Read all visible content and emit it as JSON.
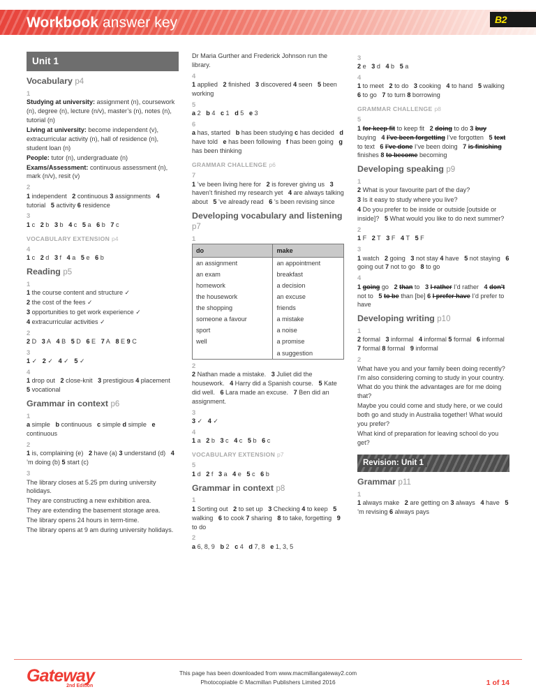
{
  "header": {
    "title_bold": "Workbook",
    "title_light": " answer key",
    "level_badge": "B2"
  },
  "column1": {
    "unit_bar": "Unit 1",
    "sections": [
      {
        "kind": "section",
        "title": "Vocabulary",
        "page": "p4"
      },
      {
        "kind": "exno",
        "text": "1"
      },
      {
        "kind": "ans",
        "html": "<b>Studying at university:</b> assignment (n), coursework (n), degree (n), lecture (n/v), master&rsquo;s (n), notes (n), tutorial (n)"
      },
      {
        "kind": "ans",
        "html": "<b>Living at university:</b> become independent (v), extracurricular activity (n), hall of residence (n), student loan (n)"
      },
      {
        "kind": "ans",
        "html": "<b>People:</b> tutor (n), undergraduate (n)"
      },
      {
        "kind": "ans",
        "html": "<b>Exams/Assessment:</b> continuous assessment (n), mark (n/v), resit (v)"
      },
      {
        "kind": "exno",
        "text": "2"
      },
      {
        "kind": "ans",
        "html": "<b>1</b> independent&nbsp;&nbsp; <b>2</b> continuous <b>3</b> assignments&nbsp;&nbsp; <b>4</b> tutorial&nbsp;&nbsp; <b>5</b> activity <b>6</b> residence"
      },
      {
        "kind": "exno",
        "text": "3"
      },
      {
        "kind": "ans",
        "html": "<b>1</b> c&nbsp;&nbsp; <b>2</b> b&nbsp;&nbsp; <b>3</b> b&nbsp;&nbsp; <b>4</b> c&nbsp;&nbsp; <b>5</b> a&nbsp;&nbsp; <b>6</b> b&nbsp;&nbsp; <b>7</b> c"
      },
      {
        "kind": "subsec",
        "title": "VOCABULARY EXTENSION",
        "page": "p4"
      },
      {
        "kind": "exno",
        "text": "4"
      },
      {
        "kind": "ans",
        "html": "<b>1</b> c&nbsp;&nbsp; <b>2</b> d&nbsp;&nbsp; <b>3</b> f&nbsp;&nbsp; <b>4</b> a&nbsp;&nbsp; <b>5</b> e&nbsp;&nbsp; <b>6</b> b"
      },
      {
        "kind": "section",
        "title": "Reading",
        "page": "p5"
      },
      {
        "kind": "exno",
        "text": "1"
      },
      {
        "kind": "ans",
        "html": "<b>1</b> the course content and structure &#10003;"
      },
      {
        "kind": "ans",
        "html": "<b>2</b> the cost of the fees &#10003;"
      },
      {
        "kind": "ans",
        "html": "<b>3</b> opportunities to get work experience &#10003;"
      },
      {
        "kind": "ans",
        "html": "<b>4</b> extracurricular activities &#10003;"
      },
      {
        "kind": "exno",
        "text": "2"
      },
      {
        "kind": "ans",
        "html": "<b>2</b> D&nbsp;&nbsp; <b>3</b> A&nbsp;&nbsp; <b>4</b> B&nbsp;&nbsp; <b>5</b> D&nbsp;&nbsp; <b>6</b> E&nbsp;&nbsp; <b>7</b> A&nbsp;&nbsp; <b>8</b> E <b>9</b> C"
      },
      {
        "kind": "exno",
        "text": "3"
      },
      {
        "kind": "ans",
        "html": "<b>1</b> &#10003;&nbsp;&nbsp; <b>2</b> &#10003;&nbsp;&nbsp; <b>4</b> &#10003;&nbsp;&nbsp; <b>5</b> &#10003;"
      },
      {
        "kind": "exno",
        "text": "4"
      },
      {
        "kind": "ans",
        "html": "<b>1</b> drop out&nbsp;&nbsp; <b>2</b> close-knit&nbsp;&nbsp; <b>3</b> prestigious <b>4</b> placement&nbsp;&nbsp; <b>5</b> vocational"
      },
      {
        "kind": "section",
        "title": "Grammar in context",
        "page": "p6"
      },
      {
        "kind": "exno",
        "text": "1"
      },
      {
        "kind": "ans",
        "html": "<b>a</b> simple&nbsp;&nbsp; <b>b</b> continuous&nbsp;&nbsp; <b>c</b> simple <b>d</b> simple&nbsp;&nbsp; <b>e</b> continuous"
      },
      {
        "kind": "exno",
        "text": "2"
      },
      {
        "kind": "ans",
        "html": "<b>1</b> is, complaining (e)&nbsp;&nbsp; <b>2</b> have (a) <b>3</b> understand (d)&nbsp;&nbsp; <b>4</b> &rsquo;m doing (b) <b>5</b> start (c)"
      },
      {
        "kind": "exno",
        "text": "3"
      },
      {
        "kind": "ans",
        "html": "The library closes at 5.25 pm during university holidays."
      },
      {
        "kind": "ans",
        "html": "They are constructing a new exhibition area."
      },
      {
        "kind": "ans",
        "html": "They are extending the basement storage area."
      },
      {
        "kind": "ans",
        "html": "The library opens 24 hours in term-time."
      },
      {
        "kind": "ans",
        "html": "The library opens at 9 am during university holidays."
      }
    ]
  },
  "column2": {
    "sections": [
      {
        "kind": "ans",
        "html": "Dr Maria Gurther and Frederick Johnson run the library."
      },
      {
        "kind": "exno",
        "text": "4"
      },
      {
        "kind": "ans",
        "html": "<b>1</b> applied&nbsp;&nbsp; <b>2</b> finished&nbsp;&nbsp; <b>3</b> discovered <b>4</b> seen&nbsp;&nbsp; <b>5</b> been working"
      },
      {
        "kind": "exno",
        "text": "5"
      },
      {
        "kind": "ans",
        "html": "<b>a</b> 2&nbsp;&nbsp; <b>b</b> 4&nbsp;&nbsp; <b>c</b> 1&nbsp;&nbsp; <b>d</b> 5&nbsp;&nbsp; <b>e</b> 3"
      },
      {
        "kind": "exno",
        "text": "6"
      },
      {
        "kind": "ans",
        "html": "<b>a</b> has, started&nbsp;&nbsp; <b>b</b> has been studying <b>c</b> has decided&nbsp;&nbsp; <b>d</b> have told&nbsp;&nbsp; <b>e</b> has been following&nbsp;&nbsp; <b>f</b> has been going&nbsp;&nbsp; <b>g</b> has been thinking"
      },
      {
        "kind": "subsec",
        "title": "GRAMMAR CHALLENGE",
        "page": "p6"
      },
      {
        "kind": "exno",
        "text": "7"
      },
      {
        "kind": "ans",
        "html": "<b>1</b> &rsquo;ve been living here for&nbsp;&nbsp; <b>2</b> is forever giving us&nbsp;&nbsp; <b>3</b> haven&rsquo;t finished my research yet&nbsp;&nbsp; <b>4</b> are always talking about&nbsp;&nbsp; <b>5</b> &rsquo;ve already read&nbsp;&nbsp; <b>6</b> &rsquo;s been revising since"
      },
      {
        "kind": "section",
        "title": "Developing vocabulary and listening",
        "page": "p7"
      },
      {
        "kind": "exno",
        "text": "1"
      },
      {
        "kind": "table"
      },
      {
        "kind": "exno",
        "text": "2"
      },
      {
        "kind": "ans",
        "html": "<b>2</b> Nathan made a mistake.&nbsp;&nbsp; <b>3</b> Juliet did the housework.&nbsp;&nbsp; <b>4</b> Harry did a Spanish course.&nbsp;&nbsp; <b>5</b> Kate did well.&nbsp;&nbsp; <b>6</b> Lara made an excuse.&nbsp;&nbsp; <b>7</b> Ben did an assignment."
      },
      {
        "kind": "exno",
        "text": "3"
      },
      {
        "kind": "ans",
        "html": "<b>3</b> &#10003;&nbsp;&nbsp; <b>4</b> &#10003;"
      },
      {
        "kind": "exno",
        "text": "4"
      },
      {
        "kind": "ans",
        "html": "<b>1</b> a&nbsp;&nbsp; <b>2</b> b&nbsp;&nbsp; <b>3</b> c&nbsp;&nbsp; <b>4</b> c&nbsp;&nbsp; <b>5</b> b&nbsp;&nbsp; <b>6</b> c"
      },
      {
        "kind": "subsec",
        "title": "VOCABULARY EXTENSION",
        "page": "p7"
      },
      {
        "kind": "exno",
        "text": "5"
      },
      {
        "kind": "ans",
        "html": "<b>1</b> d&nbsp;&nbsp; <b>2</b> f&nbsp;&nbsp; <b>3</b> a&nbsp;&nbsp; <b>4</b> e&nbsp;&nbsp; <b>5</b> c&nbsp;&nbsp; <b>6</b> b"
      },
      {
        "kind": "section",
        "title": "Grammar in context",
        "page": "p8"
      },
      {
        "kind": "exno",
        "text": "1"
      },
      {
        "kind": "ans",
        "html": "<b>1</b> Sorting out&nbsp;&nbsp; <b>2</b> to set up&nbsp;&nbsp; <b>3</b> Checking <b>4</b> to keep&nbsp;&nbsp; <b>5</b> walking&nbsp;&nbsp; <b>6</b> to cook <b>7</b> sharing&nbsp;&nbsp; <b>8</b> to take, forgetting&nbsp;&nbsp; <b>9</b> to do"
      },
      {
        "kind": "exno",
        "text": "2"
      },
      {
        "kind": "ans",
        "html": "<b>a</b> 6, 8, 9&nbsp;&nbsp; <b>b</b> 2&nbsp;&nbsp; <b>c</b> 4&nbsp;&nbsp; <b>d</b> 7, 8&nbsp;&nbsp; <b>e</b> 1, 3, 5"
      }
    ],
    "table": {
      "headers": [
        "do",
        "make"
      ],
      "rows": [
        [
          "an assignment",
          "an appointment"
        ],
        [
          "an exam",
          "breakfast"
        ],
        [
          "homework",
          "a decision"
        ],
        [
          "the housework",
          "an excuse"
        ],
        [
          "the shopping",
          "friends"
        ],
        [
          "someone a favour",
          "a mistake"
        ],
        [
          "sport",
          "a noise"
        ],
        [
          "well",
          "a promise"
        ],
        [
          "",
          "a suggestion"
        ]
      ]
    }
  },
  "column3": {
    "sections": [
      {
        "kind": "exno",
        "text": "3"
      },
      {
        "kind": "ans",
        "html": "<b>2</b> e&nbsp;&nbsp; <b>3</b> d&nbsp;&nbsp; <b>4</b> b&nbsp;&nbsp; <b>5</b> a"
      },
      {
        "kind": "exno",
        "text": "4"
      },
      {
        "kind": "ans",
        "html": "<b>1</b> to meet&nbsp;&nbsp; <b>2</b> to do&nbsp;&nbsp; <b>3</b> cooking&nbsp;&nbsp; <b>4</b> to hand&nbsp;&nbsp; <b>5</b> walking&nbsp;&nbsp; <b>6</b> to go&nbsp;&nbsp; <b>7</b> to turn <b>8</b> borrowing"
      },
      {
        "kind": "subsec",
        "title": "GRAMMAR CHALLENGE",
        "page": "p8"
      },
      {
        "kind": "exno",
        "text": "5"
      },
      {
        "kind": "ans",
        "html": "<b>1</b> <span class=\"strike\">for keep fit</span> to keep fit&nbsp;&nbsp; <b>2</b> <span class=\"strike\">doing</span> to do <b>3</b> <span class=\"strike\">buy</span> buying&nbsp;&nbsp; <b>4</b> <span class=\"strike\">I&rsquo;ve been forgetting</span> I&rsquo;ve forgotten&nbsp;&nbsp; <b>5</b> <span class=\"strike\">text</span> to text&nbsp;&nbsp; <b>6</b> <span class=\"strike\">I&rsquo;ve done</span> I&rsquo;ve been doing&nbsp;&nbsp; <b>7</b> <span class=\"strike\">is finishing</span> finishes <b>8</b> <span class=\"strike\">to become</span> becoming"
      },
      {
        "kind": "section",
        "title": "Developing speaking",
        "page": "p9"
      },
      {
        "kind": "exno",
        "text": "1"
      },
      {
        "kind": "ans",
        "html": "<b>2</b> What is your favourite part of the day?"
      },
      {
        "kind": "ans",
        "html": "<b>3</b> Is it easy to study where you live?"
      },
      {
        "kind": "ans",
        "html": "<b>4</b> Do you prefer to be inside or outside [outside or inside]?&nbsp;&nbsp; <b>5</b> What would you like to do next summer?"
      },
      {
        "kind": "exno",
        "text": "2"
      },
      {
        "kind": "ans",
        "html": "<b>1</b> F&nbsp;&nbsp; <b>2</b> T&nbsp;&nbsp; <b>3</b> F&nbsp;&nbsp; <b>4</b> T&nbsp;&nbsp; <b>5</b> F"
      },
      {
        "kind": "exno",
        "text": "3"
      },
      {
        "kind": "ans",
        "html": "<b>1</b> watch&nbsp;&nbsp; <b>2</b> going&nbsp;&nbsp; <b>3</b> not stay <b>4</b> have&nbsp;&nbsp; <b>5</b> not staying&nbsp;&nbsp; <b>6</b> going out <b>7</b> not to go&nbsp;&nbsp; <b>8</b> to go"
      },
      {
        "kind": "exno",
        "text": "4"
      },
      {
        "kind": "ans",
        "html": "<b>1</b> <span class=\"strike\">going</span> go&nbsp;&nbsp; <b>2</b> <span class=\"strike\">than</span> to&nbsp;&nbsp; <b>3</b> <span class=\"strike\">I rather</span> I&rsquo;d rather&nbsp;&nbsp; <b>4</b> <span class=\"strike\">don&rsquo;t</span> not to&nbsp;&nbsp; <b>5</b> <span class=\"strike\">to be</span> than [be] <b>6</b> <span class=\"strike\">I prefer have</span> I&rsquo;d prefer to have"
      },
      {
        "kind": "section",
        "title": "Developing writing",
        "page": "p10"
      },
      {
        "kind": "exno",
        "text": "1"
      },
      {
        "kind": "ans",
        "html": "<b>2</b> formal&nbsp;&nbsp; <b>3</b> informal&nbsp;&nbsp; <b>4</b> informal <b>5</b> formal&nbsp;&nbsp; <b>6</b> informal&nbsp;&nbsp; <b>7</b> formal <b>8</b> formal&nbsp;&nbsp; <b>9</b> informal"
      },
      {
        "kind": "exno",
        "text": "2"
      },
      {
        "kind": "ans",
        "html": "What have you and your family been doing recently?"
      },
      {
        "kind": "ans",
        "html": "I&rsquo;m also considering coming to study in your country. What do you think the advantages are for me doing that?"
      },
      {
        "kind": "ans",
        "html": "Maybe you could come and study here, or we could both go and study in Australia together! What would you prefer?"
      },
      {
        "kind": "ans",
        "html": "What kind of preparation for leaving school do you get?"
      },
      {
        "kind": "revision",
        "text": "Revision: Unit 1"
      },
      {
        "kind": "section",
        "title": "Grammar",
        "page": "p11"
      },
      {
        "kind": "exno",
        "text": "1"
      },
      {
        "kind": "ans",
        "html": "<b>1</b> always make&nbsp;&nbsp; <b>2</b> are getting on <b>3</b> always&nbsp;&nbsp; <b>4</b> have&nbsp;&nbsp; <b>5</b> &rsquo;m revising <b>6</b> always pays"
      }
    ]
  },
  "footer": {
    "logo": "Gateway",
    "logo_edition": "2nd Edition",
    "line1": "This page has been downloaded from www.macmillangateway2.com",
    "line2": "Photocopiable © Macmillan Publishers Limited 2016",
    "page_number": "1 of 14"
  },
  "colors": {
    "brand_red": "#ee3b33",
    "unit_bar_gray": "#6e6e6e",
    "revision_bar_gray": "#4d4d4d",
    "badge_yellow": "#ffe800"
  }
}
